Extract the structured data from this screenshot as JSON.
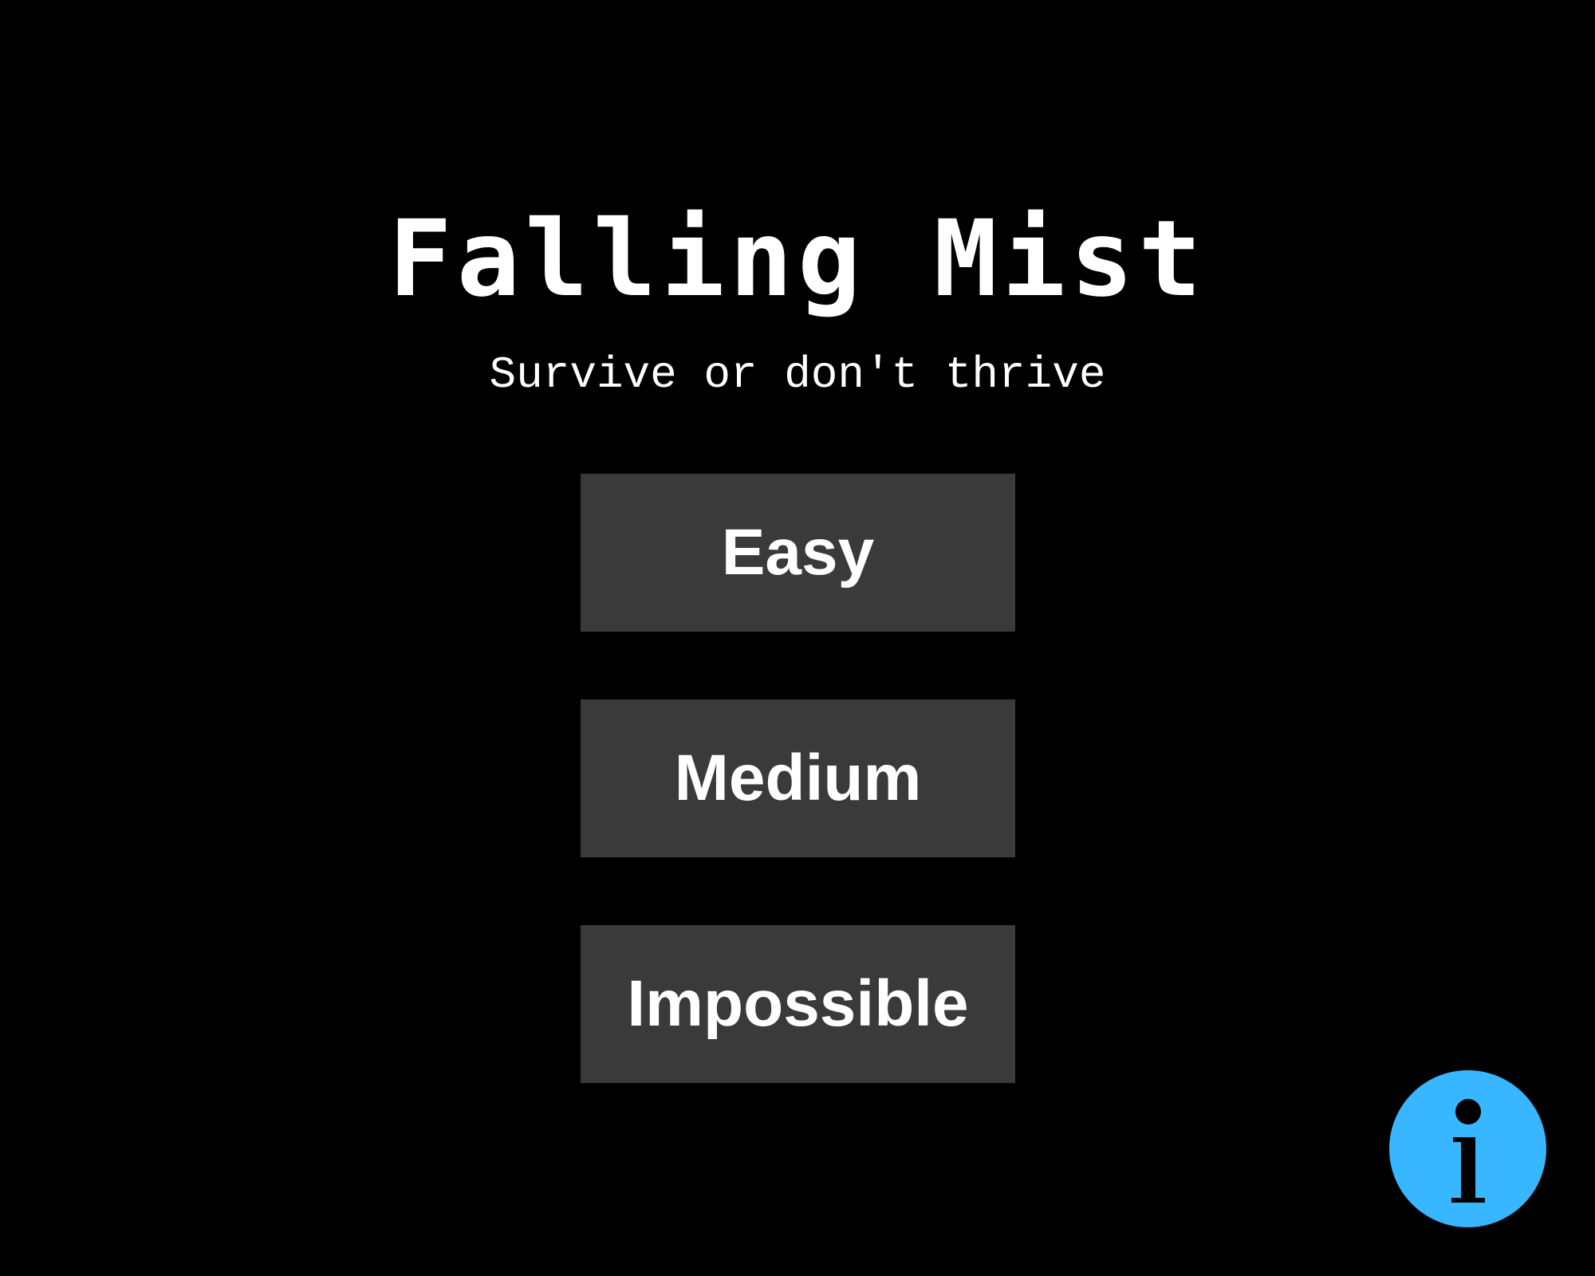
{
  "title": "Falling Mist",
  "subtitle": "Survive or don't thrive",
  "menu": {
    "buttons": [
      {
        "label": "Easy"
      },
      {
        "label": "Medium"
      },
      {
        "label": "Impossible"
      }
    ]
  },
  "info_icon": "info-icon",
  "colors": {
    "background": "#000000",
    "button_bg": "#3a3a3a",
    "text": "#ffffff",
    "info_accent": "#38b6ff"
  }
}
